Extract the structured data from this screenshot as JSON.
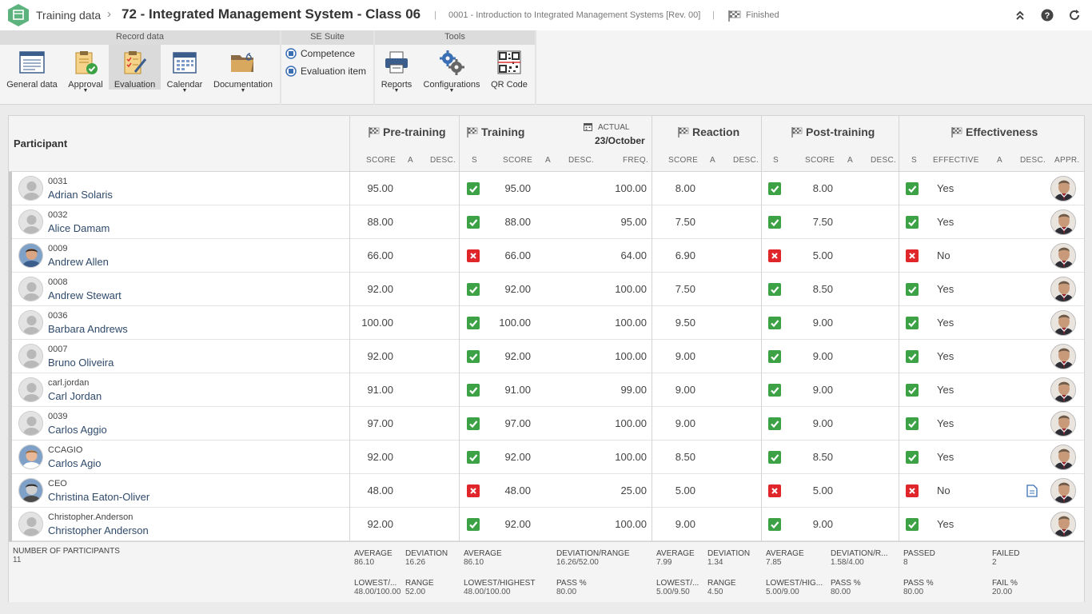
{
  "topbar": {
    "breadcrumb": "Training data",
    "title": "72 - Integrated Management System - Class 06",
    "subtitle": "0001 - Introduction to Integrated Management Systems [Rev. 00]",
    "status": "Finished"
  },
  "ribbon": {
    "groups": {
      "record_data": "Record data",
      "se_suite": "SE Suite",
      "tools": "Tools"
    },
    "buttons": {
      "general_data": "General data",
      "approval": "Approval",
      "evaluation": "Evaluation",
      "calendar": "Calendar",
      "documentation": "Documentation",
      "competence": "Competence",
      "evaluation_item": "Evaluation item",
      "reports": "Reports",
      "configurations": "Configurations",
      "qr_code": "QR Code"
    }
  },
  "grid": {
    "participant_header": "Participant",
    "groups": {
      "pre": "Pre-training",
      "training": "Training",
      "actual_label": "ACTUAL",
      "actual_date": "23/October",
      "reaction": "Reaction",
      "post": "Post-training",
      "effectiveness": "Effectiveness"
    },
    "subheaders": {
      "score": "SCORE",
      "a": "A",
      "desc": "DESC.",
      "s": "S",
      "freq": "FREQ.",
      "effective": "EFFECTIVE",
      "appr": "APPR."
    },
    "rows": [
      {
        "id": "0031",
        "name": "Adrian Solaris",
        "pre": "95.00",
        "train_ok": true,
        "train": "95.00",
        "freq": "100.00",
        "reaction": "8.00",
        "post_ok": true,
        "post": "8.00",
        "eff_ok": true,
        "effective": "Yes",
        "avatar": "default",
        "doc": false
      },
      {
        "id": "0032",
        "name": "Alice Damam",
        "pre": "88.00",
        "train_ok": true,
        "train": "88.00",
        "freq": "95.00",
        "reaction": "7.50",
        "post_ok": true,
        "post": "7.50",
        "eff_ok": true,
        "effective": "Yes",
        "avatar": "default",
        "doc": false
      },
      {
        "id": "0009",
        "name": "Andrew Allen",
        "pre": "66.00",
        "train_ok": false,
        "train": "66.00",
        "freq": "64.00",
        "reaction": "6.90",
        "post_ok": false,
        "post": "5.00",
        "eff_ok": false,
        "effective": "No",
        "avatar": "photo",
        "doc": false
      },
      {
        "id": "0008",
        "name": "Andrew Stewart",
        "pre": "92.00",
        "train_ok": true,
        "train": "92.00",
        "freq": "100.00",
        "reaction": "7.50",
        "post_ok": true,
        "post": "8.50",
        "eff_ok": true,
        "effective": "Yes",
        "avatar": "default",
        "doc": false
      },
      {
        "id": "0036",
        "name": "Barbara Andrews",
        "pre": "100.00",
        "train_ok": true,
        "train": "100.00",
        "freq": "100.00",
        "reaction": "9.50",
        "post_ok": true,
        "post": "9.00",
        "eff_ok": true,
        "effective": "Yes",
        "avatar": "default",
        "doc": false
      },
      {
        "id": "0007",
        "name": "Bruno Oliveira",
        "pre": "92.00",
        "train_ok": true,
        "train": "92.00",
        "freq": "100.00",
        "reaction": "9.00",
        "post_ok": true,
        "post": "9.00",
        "eff_ok": true,
        "effective": "Yes",
        "avatar": "default",
        "doc": false
      },
      {
        "id": "carl.jordan",
        "name": "Carl Jordan",
        "pre": "91.00",
        "train_ok": true,
        "train": "91.00",
        "freq": "99.00",
        "reaction": "9.00",
        "post_ok": true,
        "post": "9.00",
        "eff_ok": true,
        "effective": "Yes",
        "avatar": "default",
        "doc": false
      },
      {
        "id": "0039",
        "name": "Carlos Aggio",
        "pre": "97.00",
        "train_ok": true,
        "train": "97.00",
        "freq": "100.00",
        "reaction": "9.00",
        "post_ok": true,
        "post": "9.00",
        "eff_ok": true,
        "effective": "Yes",
        "avatar": "default",
        "doc": false
      },
      {
        "id": "CCAGIO",
        "name": "Carlos Agio",
        "pre": "92.00",
        "train_ok": true,
        "train": "92.00",
        "freq": "100.00",
        "reaction": "8.50",
        "post_ok": true,
        "post": "8.50",
        "eff_ok": true,
        "effective": "Yes",
        "avatar": "photo2",
        "doc": false
      },
      {
        "id": "CEO",
        "name": "Christina Eaton-Oliver",
        "pre": "48.00",
        "train_ok": false,
        "train": "48.00",
        "freq": "25.00",
        "reaction": "5.00",
        "post_ok": false,
        "post": "5.00",
        "eff_ok": false,
        "effective": "No",
        "avatar": "photo3",
        "doc": true
      },
      {
        "id": "Christopher.Anderson",
        "name": "Christopher Anderson",
        "pre": "92.00",
        "train_ok": true,
        "train": "92.00",
        "freq": "100.00",
        "reaction": "9.00",
        "post_ok": true,
        "post": "9.00",
        "eff_ok": true,
        "effective": "Yes",
        "avatar": "default",
        "doc": false
      }
    ]
  },
  "footer": {
    "participants_label": "NUMBER OF PARTICIPANTS",
    "participants": "11",
    "pre": {
      "avg_l": "AVERAGE",
      "avg": "86.10",
      "dev_l": "DEVIATION",
      "dev": "16.26",
      "lh_l": "LOWEST/...",
      "lh": "48.00/100.00",
      "range_l": "RANGE",
      "range": "52.00"
    },
    "training": {
      "avg_l": "AVERAGE",
      "avg": "86.10",
      "dr_l": "DEVIATION/RANGE",
      "dr": "16.26/52.00",
      "lh_l": "LOWEST/HIGHEST",
      "lh": "48.00/100.00",
      "pass_l": "PASS %",
      "pass": "80.00"
    },
    "reaction": {
      "avg_l": "AVERAGE",
      "avg": "7.99",
      "dev_l": "DEVIATION",
      "dev": "1.34",
      "lh_l": "LOWEST/...",
      "lh": "5.00/9.50",
      "range_l": "RANGE",
      "range": "4.50"
    },
    "post": {
      "avg_l": "AVERAGE",
      "avg": "7.85",
      "dr_l": "DEVIATION/R...",
      "dr": "1.58/4.00",
      "lh_l": "LOWEST/HIG...",
      "lh": "5.00/9.00",
      "pass_l": "PASS %",
      "pass": "80.00"
    },
    "eff": {
      "passed_l": "PASSED",
      "passed": "8",
      "failed_l": "FAILED",
      "failed": "2",
      "pass_l": "PASS %",
      "pass": "80.00",
      "fail_l": "FAIL %",
      "fail": "20.00"
    }
  }
}
